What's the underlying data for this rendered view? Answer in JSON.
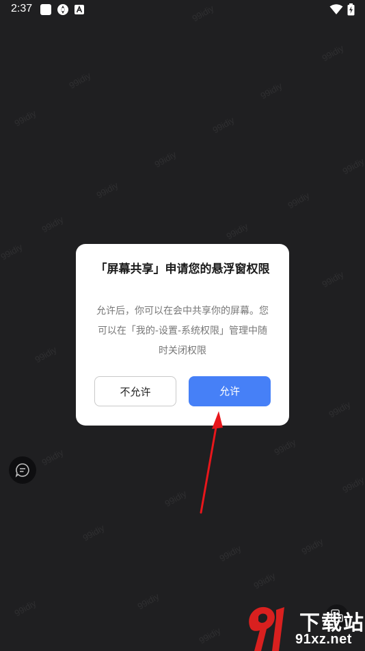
{
  "status_bar": {
    "time": "2:37",
    "icons": [
      "square-icon",
      "aperture-icon",
      "a-box-icon",
      "wifi-icon",
      "battery-charging-icon"
    ]
  },
  "watermark": {
    "text": "99idiy"
  },
  "dialog": {
    "title": "「屏幕共享」申请您的悬浮窗权限",
    "message": "允许后，你可以在会中共享你的屏幕。您可以在「我的-设置-系统权限」管理中随时关闭权限",
    "deny_label": "不允许",
    "allow_label": "允许"
  },
  "overlay": {
    "arrow_color": "#e8161b",
    "floating_icons": [
      "chat-bubble-icon",
      "screen-share-icon"
    ]
  },
  "logo": {
    "site_text": "91xz.net",
    "cn_text": "下载站",
    "brand_color": "#d9201f"
  },
  "colors": {
    "background": "#1f1f21",
    "primary_button": "#4680f7"
  }
}
